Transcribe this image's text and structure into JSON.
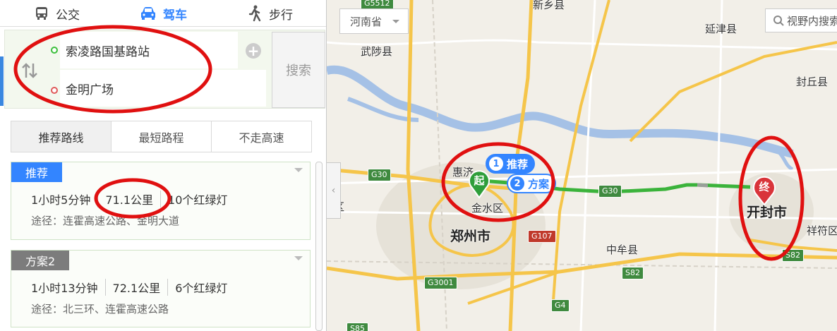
{
  "modes": [
    {
      "label": "公交",
      "icon": "bus-icon",
      "active": false
    },
    {
      "label": "驾车",
      "icon": "car-icon",
      "active": true
    },
    {
      "label": "步行",
      "icon": "walk-icon",
      "active": false
    }
  ],
  "search": {
    "start": "索凌路国基路站",
    "end": "金明广场",
    "button": "搜索"
  },
  "route_tabs": [
    "推荐路线",
    "最短路程",
    "不走高速"
  ],
  "plans": [
    {
      "tag": "推荐",
      "time": "1小时5分钟",
      "distance": "71.1公里",
      "lights": "10个红绿灯",
      "via": "途径：连霍高速公路、金明大道"
    },
    {
      "tag": "方案2",
      "time": "1小时13分钟",
      "distance": "72.1公里",
      "lights": "6个红绿灯",
      "via": "途径：北三环、连霍高速公路"
    }
  ],
  "map": {
    "province": "河南省",
    "view_search_placeholder": "视野内搜索",
    "places": {
      "xinxiang": "新乡县",
      "yanjin": "延津县",
      "wuling": "武陟县",
      "fengqiu": "封丘县",
      "huiji": "惠济",
      "jinshui": "金水区",
      "zhengzhou": "郑州市",
      "zhongmou": "中牟县",
      "kaifeng": "开封市",
      "xiangfu": "祥符区",
      "qu": "区"
    },
    "roads": {
      "g5512": "G5512",
      "g30a": "G30",
      "g30b": "G30",
      "g107": "G107",
      "g3001": "G3001",
      "g4": "G4",
      "s82a": "S82",
      "s82b": "S82",
      "s85": "S85"
    },
    "markers": {
      "start": "起",
      "end": "终",
      "route1_num": "1",
      "route1_label": "推荐",
      "route2_num": "2",
      "route2_label": "方案"
    },
    "colors": {
      "route": "#3bb33b",
      "water": "#a5c1e6",
      "highway": "#f5c54a",
      "annotation": "#e01010"
    }
  }
}
